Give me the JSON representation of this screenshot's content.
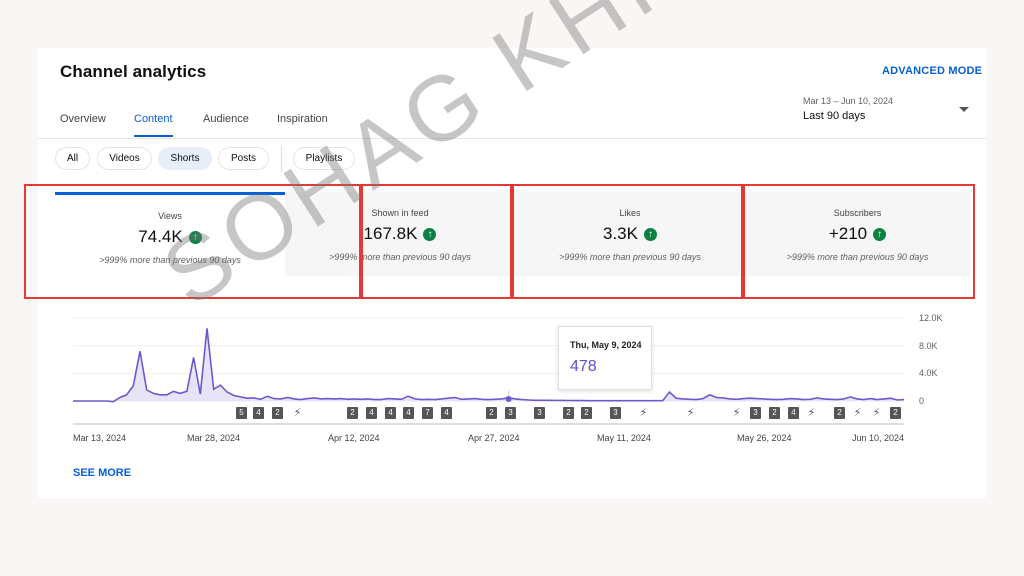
{
  "header": {
    "title": "Channel analytics",
    "advanced_mode": "ADVANCED MODE"
  },
  "tabs": [
    "Overview",
    "Content",
    "Audience",
    "Inspiration"
  ],
  "active_tab": "Content",
  "date_picker": {
    "range": "Mar 13 – Jun 10, 2024",
    "label": "Last 90 days"
  },
  "chips": [
    "All",
    "Videos",
    "Shorts",
    "Posts",
    "Playlists"
  ],
  "active_chip": "Shorts",
  "metrics": [
    {
      "label": "Views",
      "value": "74.4K",
      "sub": ">999% more than previous 90 days"
    },
    {
      "label": "Shown in feed",
      "value": "167.8K",
      "sub": ">999% more than previous 90 days"
    },
    {
      "label": "Likes",
      "value": "3.3K",
      "sub": ">999% more than previous 90 days"
    },
    {
      "label": "Subscribers",
      "value": "+210",
      "sub": ">999% more than previous 90 days"
    }
  ],
  "chart_data": {
    "type": "area",
    "y_ticks": [
      "12.0K",
      "8.0K",
      "4.0K",
      "0"
    ],
    "ylim": [
      0,
      12000
    ],
    "x_tick_labels": [
      "Mar 13, 2024",
      "Mar 28, 2024",
      "Apr 12, 2024",
      "Apr 27, 2024",
      "May 11, 2024",
      "May 26, 2024",
      "Jun 10, 2024"
    ],
    "series": [
      {
        "values": [
          0,
          0,
          0,
          0,
          0,
          0,
          -100,
          500,
          900,
          2200,
          7200,
          1600,
          1100,
          900,
          900,
          1400,
          1100,
          1400,
          6300,
          1000,
          10500,
          1700,
          2300,
          1300,
          800,
          600,
          400,
          450,
          250,
          700,
          350,
          300,
          500,
          300,
          200,
          350,
          450,
          300,
          350,
          300,
          350,
          250,
          300,
          250,
          300,
          200,
          200,
          350,
          300,
          250,
          700,
          300,
          200,
          250,
          200,
          300,
          400,
          500,
          250,
          300,
          350,
          250,
          200,
          250,
          300,
          478,
          300,
          200,
          150,
          100,
          100,
          100,
          80,
          80,
          70,
          60,
          60,
          50,
          50,
          50,
          50,
          50,
          50,
          50,
          50,
          50,
          50,
          50,
          50,
          1300,
          400,
          300,
          250,
          200,
          350,
          900,
          500,
          450,
          300,
          250,
          350,
          400,
          350,
          300,
          250,
          200,
          250,
          350,
          300,
          200,
          250,
          450,
          300,
          250,
          200,
          300,
          600,
          300,
          200,
          350,
          200,
          300,
          400,
          150,
          200
        ]
      }
    ],
    "tooltip": {
      "date": "Thu, May 9, 2024",
      "value": "478"
    },
    "upload_markers": [
      "5",
      "4",
      "2",
      "shorts-icon",
      "2",
      "4",
      "4",
      "4",
      "7",
      "4",
      "2",
      "3",
      "3",
      "2",
      "2",
      "3",
      "shorts-icon",
      "shorts-icon",
      "shorts-icon",
      "3",
      "2",
      "4",
      "shorts-icon",
      "2",
      "shorts-icon",
      "shorts-icon",
      "2",
      "3"
    ],
    "colors": {
      "line": "#6a5acd",
      "fill": "#e7e4f7",
      "baseline": "#bdbdbd"
    }
  },
  "see_more": "SEE MORE",
  "watermark": "SOHAG KHISA",
  "colors": {
    "accent": "#065fd4",
    "positive": "#0b8043",
    "highlight_box": "#e53935"
  }
}
